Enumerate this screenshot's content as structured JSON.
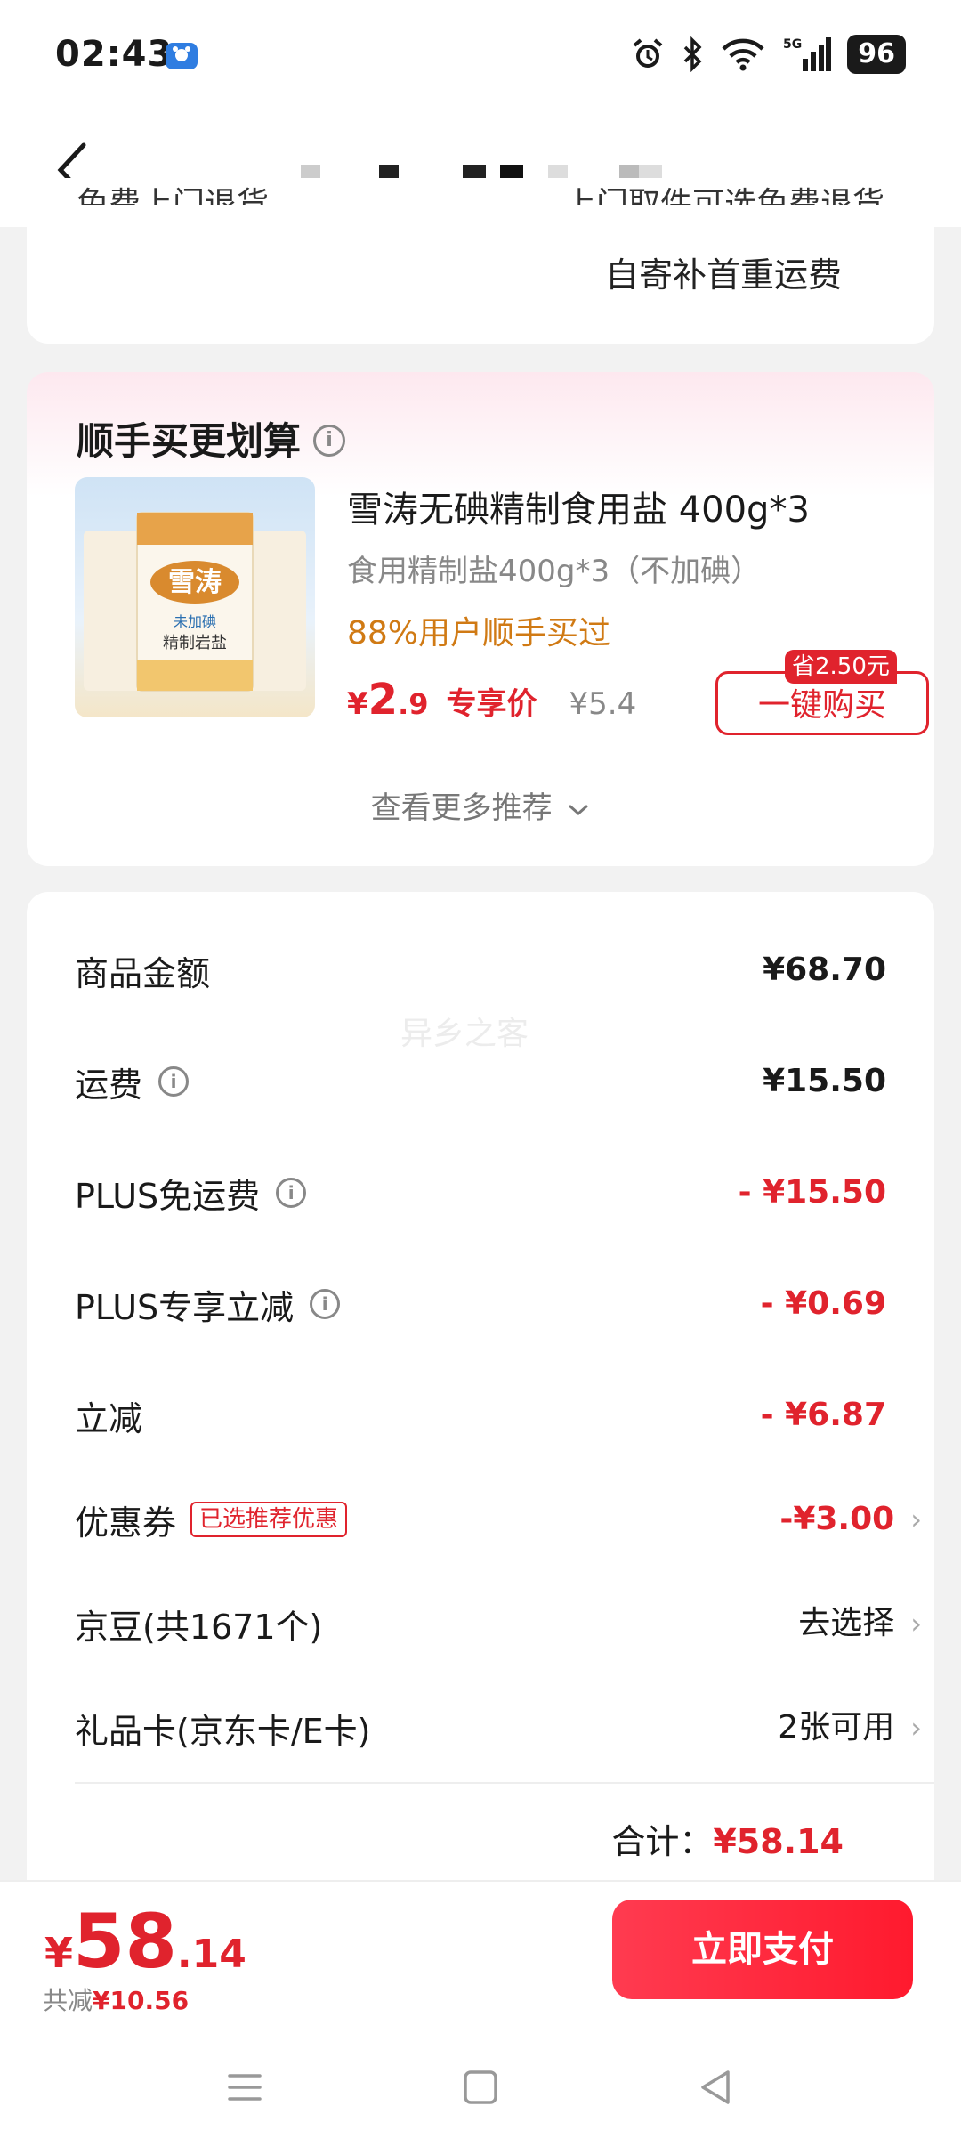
{
  "status_bar": {
    "time": "02:43",
    "battery": "96",
    "network": "5G"
  },
  "shipping_card": {
    "left_cut": "免费上门退货",
    "right_cut": "上门取件可选免费退货",
    "note": "自寄补首重运费"
  },
  "recommend": {
    "title": "顺手买更划算",
    "product": {
      "name": "雪涛无碘精制食用盐 400g*3",
      "spec": "食用精制盐400g*3（不加碘）",
      "hint": "88%用户顺手买过",
      "price_yen": "¥",
      "price_int": "2",
      "price_dec": ".9",
      "price_tag": "专享价",
      "orig_price": "¥5.4",
      "buy_label": "一键购买",
      "save_badge": "省2.50元"
    },
    "more_label": "查看更多推荐"
  },
  "summary": {
    "rows": [
      {
        "label": "商品金额",
        "value": "¥68.70"
      },
      {
        "label": "运费",
        "value": "¥15.50"
      },
      {
        "label": "PLUS免运费",
        "value": "- ¥15.50"
      },
      {
        "label": "PLUS专享立减",
        "value": "- ¥0.69"
      },
      {
        "label": "立减",
        "value": "- ¥6.87"
      },
      {
        "label": "优惠券",
        "value": "-¥3.00",
        "tag": "已选推荐优惠"
      },
      {
        "label": "京豆(共1671个)",
        "value": "去选择"
      },
      {
        "label": "礼品卡(京东卡/E卡)",
        "value": "2张可用"
      }
    ],
    "total_label": "合计：",
    "total_value": "¥58.14",
    "watermark": "异乡之客"
  },
  "bottom_bar": {
    "pay_yen": "¥",
    "pay_int": "58",
    "pay_dec": ".14",
    "save_label": "共减",
    "save_value": "¥10.56",
    "pay_button": "立即支付"
  },
  "colors": {
    "accent": "#e0232d",
    "hint": "#d07a14"
  }
}
